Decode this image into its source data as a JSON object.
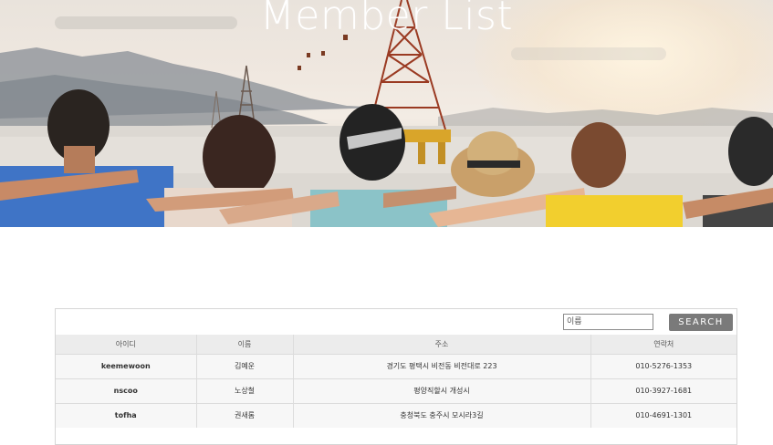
{
  "hero": {
    "title": "Member List"
  },
  "search": {
    "placeholder": "이름",
    "button_label": "SEARCH"
  },
  "table": {
    "columns": [
      "아이디",
      "이름",
      "주소",
      "연락처"
    ],
    "rows": [
      {
        "id": "keemewoon",
        "name": "김예운",
        "address": "경기도 평택시 비전동 비전대로 223",
        "phone": "010-5276-1353"
      },
      {
        "id": "nscoo",
        "name": "노상철",
        "address": "평양직할시 개성시",
        "phone": "010-3927-1681"
      },
      {
        "id": "tofha",
        "name": "권새롬",
        "address": "충청북도 충주시 모시라3길",
        "phone": "010-4691-1301"
      }
    ]
  },
  "colors": {
    "button_bg": "#7a7a7a",
    "header_bg": "#ececec",
    "row_bg": "#f7f7f7"
  }
}
